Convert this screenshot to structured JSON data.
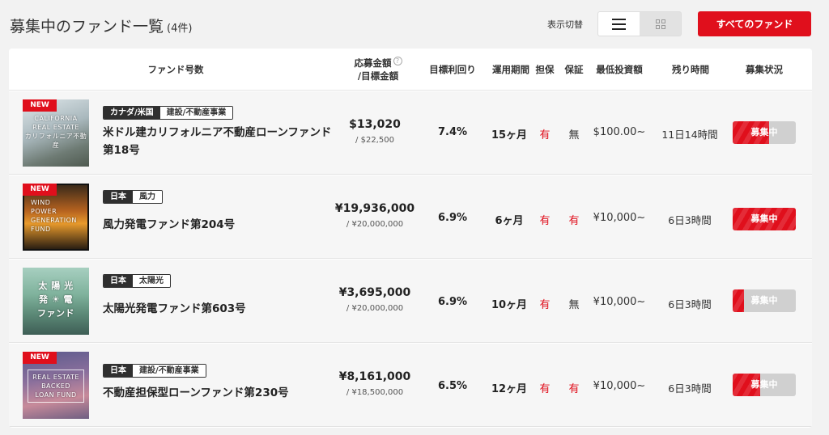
{
  "header": {
    "title": "募集中のファンド一覧",
    "count": "(4件)"
  },
  "view_toggle": {
    "label": "表示切替",
    "active": "list"
  },
  "all_funds_button": "すべてのファンド",
  "columns": {
    "fund": "ファンド号数",
    "amount_line1": "応募金額",
    "amount_line2": "/目標金額",
    "help": "?",
    "yield": "目標利回り",
    "period": "運用期間",
    "collateral": "担保",
    "guarantee": "保証",
    "min_invest": "最低投資額",
    "remaining": "残り時間",
    "status": "募集状況"
  },
  "colors": {
    "accent": "#e00f1c",
    "dark_tag": "#2f2f2f"
  },
  "funds": [
    {
      "is_new": true,
      "new_label": "NEW",
      "thumb_text": "CALIFORNIA\nREAL ESTATE\nカリフォルニア不動産",
      "thumb_icon": "california-real-estate-thumbnail",
      "country": "カナダ/米国",
      "category": "建設/不動産事業",
      "name": "米ドル建カリフォルニア不動産ローンファンド第18号",
      "amount": "$13,020",
      "target": "/ $22,500",
      "yield": "7.4%",
      "period": "15ヶ月",
      "collateral": "有",
      "guarantee": "無",
      "min_invest": "$100.00~",
      "remaining": "11日14時間",
      "status": "募集中",
      "progress": 0.58
    },
    {
      "is_new": true,
      "new_label": "NEW",
      "thumb_text": "WIND\nPOWER\nGENERATION\nFUND",
      "thumb_icon": "wind-power-thumbnail",
      "country": "日本",
      "category": "風力",
      "name": "風力発電ファンド第204号",
      "amount": "¥19,936,000",
      "target": "/ ¥20,000,000",
      "yield": "6.9%",
      "period": "6ヶ月",
      "collateral": "有",
      "guarantee": "有",
      "min_invest": "¥10,000~",
      "remaining": "6日3時間",
      "status": "募集中",
      "progress": 0.997
    },
    {
      "is_new": false,
      "new_label": "",
      "thumb_text": "太 陽 光\n発 ☀ 電\nファンド",
      "thumb_icon": "solar-power-thumbnail",
      "country": "日本",
      "category": "太陽光",
      "name": "太陽光発電ファンド第603号",
      "amount": "¥3,695,000",
      "target": "/ ¥20,000,000",
      "yield": "6.9%",
      "period": "10ヶ月",
      "collateral": "有",
      "guarantee": "無",
      "min_invest": "¥10,000~",
      "remaining": "6日3時間",
      "status": "募集中",
      "progress": 0.185
    },
    {
      "is_new": true,
      "new_label": "NEW",
      "thumb_text": "REAL ESTATE\nBACKED\nLOAN FUND",
      "thumb_icon": "real-estate-backed-loan-thumbnail",
      "country": "日本",
      "category": "建設/不動産事業",
      "name": "不動産担保型ローンファンド第230号",
      "amount": "¥8,161,000",
      "target": "/ ¥18,500,000",
      "yield": "6.5%",
      "period": "12ヶ月",
      "collateral": "有",
      "guarantee": "有",
      "min_invest": "¥10,000~",
      "remaining": "6日3時間",
      "status": "募集中",
      "progress": 0.44
    }
  ]
}
